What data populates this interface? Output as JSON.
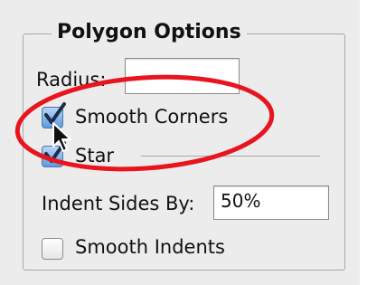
{
  "dialog": {
    "group_title": "Polygon Options",
    "radius": {
      "label": "Radius:",
      "value": ""
    },
    "smooth_corners": {
      "label": "Smooth Corners",
      "checked": true
    },
    "star": {
      "label": "Star",
      "checked": true
    },
    "indent_sides_by": {
      "label": "Indent Sides By:",
      "value": "50%"
    },
    "smooth_indents": {
      "label": "Smooth Indents",
      "checked": false
    }
  },
  "annotation": {
    "highlight_color": "#e8141e"
  },
  "icons": {
    "checkmark": "checkmark-icon",
    "cursor": "arrow-cursor-icon"
  }
}
